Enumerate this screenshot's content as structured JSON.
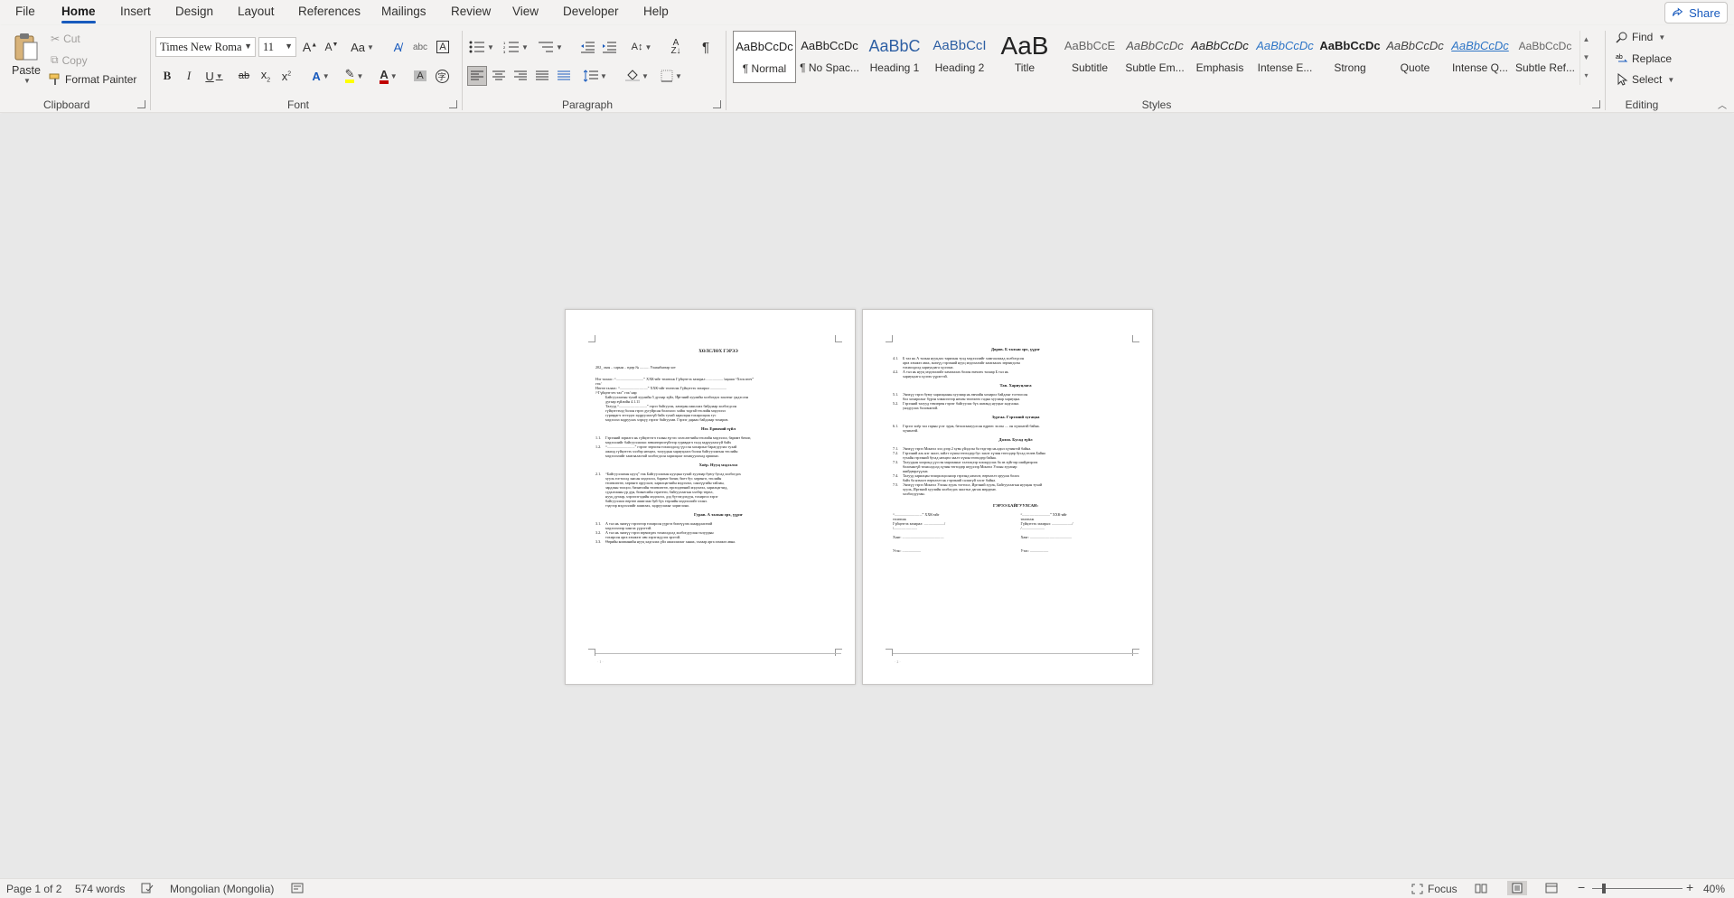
{
  "tabs": [
    "File",
    "Home",
    "Insert",
    "Design",
    "Layout",
    "References",
    "Mailings",
    "Review",
    "View",
    "Developer",
    "Help"
  ],
  "active_tab": "Home",
  "share_label": "Share",
  "clipboard": {
    "paste": "Paste",
    "cut": "Cut",
    "copy": "Copy",
    "format_painter": "Format Painter",
    "label": "Clipboard"
  },
  "font": {
    "name": "Times New Roma",
    "size": "11",
    "label": "Font"
  },
  "paragraph": {
    "label": "Paragraph"
  },
  "styles": {
    "label": "Styles",
    "items": [
      {
        "preview": "AaBbCcDc",
        "name": "¶ Normal"
      },
      {
        "preview": "AaBbCcDc",
        "name": "¶ No Spac..."
      },
      {
        "preview": "AaBbC",
        "name": "Heading 1"
      },
      {
        "preview": "AaBbCcI",
        "name": "Heading 2"
      },
      {
        "preview": "AaB",
        "name": "Title"
      },
      {
        "preview": "AaBbCcE",
        "name": "Subtitle"
      },
      {
        "preview": "AaBbCcDc",
        "name": "Subtle Em..."
      },
      {
        "preview": "AaBbCcDc",
        "name": "Emphasis"
      },
      {
        "preview": "AaBbCcDc",
        "name": "Intense E..."
      },
      {
        "preview": "AaBbCcDc",
        "name": "Strong"
      },
      {
        "preview": "AaBbCcDc",
        "name": "Quote"
      },
      {
        "preview": "AaBbCcDc",
        "name": "Intense Q..."
      },
      {
        "preview": "AaBbCcDc",
        "name": "Subtle Ref..."
      }
    ]
  },
  "editing": {
    "find": "Find",
    "replace": "Replace",
    "select": "Select",
    "label": "Editing"
  },
  "page1": {
    "title": "ХӨЛСЛӨХ ГЭРЭЭ",
    "meta": "202_ оны .. сарын .. өдөр                    № ..........                                          Улаанбаатар хот",
    "intro": [
      "Нэг талаас: “..............................” ХХК-ийг төлөөлж Гүйцэтгэх захирал .................. /ацааш “Хөлслөгч”",
      "гэх/",
      "Нөгөө талаас: “..............................” ХХК-ийг төлөөлж Гүйцэтгэх захирал ..................",
      "/“Гүйцэтгэгч тал” гэх/ нар",
      "Байгууллагын тухай хуулийн 5 дугаар зүйл, Иргэний хуулийн холбогдох заалтыг үндэслэн",
      "дугаар зүйлийн 4.1.11",
      "Талууд “..............................” гэрээ байгуулж, хамтран ажиллах байдлаар холбогдсон",
      "гүйцэтгэхэд болон гэрээ дугуйрсан болохоос хойш тадгай төслийн мэдээлэл",
      "гуравдагч этгээдээ задруулахгүй байх тухай харилцан тохиролцож тус",
      "мэдээлэл задруулах хэрхүү гэрээг байгуулав. Гэрээг дараах байдлаар тохиров."
    ],
    "sections": [
      {
        "head": "Нэг. Ерөнхий зүйл",
        "lines": [
          {
            "n": "1.1.",
            "t": "Гэрээний зорилго нь гүйцэтгэгч талын зүгээс хөлслөгчийн төслийн мэдээлэл, баримт бичиг,"
          },
          {
            "n": "",
            "t": "мэдээллийг байгууллагаас зөвшөөрөлгүйгээр гуравдагч талд задруулахгүй байх"
          },
          {
            "n": "1.2.",
            "t": "“..............................” гэрээг зөрчсөн тохиолдолд үүссэн хохирлыг барагдуулах тухай"
          },
          {
            "n": "",
            "t": "ажилд гүйцэтгэх хэлбэр нөхцөл, талуудын хариуцлага болон байгууллагын төслийн"
          },
          {
            "n": "",
            "t": "мэдээлэлийг хамгаалахтай холбогдсон харилцааг зохицуулахад оршино."
          }
        ]
      },
      {
        "head": "Хоёр. Нууц мэдээлэл",
        "lines": [
          {
            "n": "2.1.",
            "t": "“Байгууллагын нууц” гэж Байгууллагын нууцын тухай хуулиар буюу бусад холбогдох"
          },
          {
            "n": "",
            "t": "хууль тогтоолд заасан мэдээлэл, баримт бичиг, биет бус хөрөнгө, төслийн"
          },
          {
            "n": "",
            "t": "төлөвлөгөө, хөрөнгө оруулалт, харилцагчийн мэдээлэл, санхүүгийн тайлан,"
          },
          {
            "n": "",
            "t": "зардлын тооцоо, бизнесийн төлөвлөгөө, өрсөлдөөний мэдээлэл, харилцагчид,"
          },
          {
            "n": "",
            "t": "судалгааны үр дүн, бизнесийн стратеги, байгууллагын хэлбэр төрөл,"
          },
          {
            "n": "",
            "t": "нууц дугаар, хэрэглэгчдийн мэдээлэл, дэд бүтээгдэхүүн, тохиргоо зэрэг"
          },
          {
            "n": "",
            "t": "байгууллага өөртөө ашиглаж буй бүх төрлийн мэдээллийг хэлнэ."
          },
          {
            "n": "",
            "t": "тэдгээр мэдээллийг ашиглах, задруулахыг хориглоно."
          }
        ]
      },
      {
        "head": "Гурав. А талын эрх, үүрэг",
        "lines": [
          {
            "n": "3.1.",
            "t": "А тал нь энэхүү гэрээгээр тохирсон үүргээ биелүүлэх шаардлагатай"
          },
          {
            "n": "",
            "t": "мэдээлэлээр хангах үүрэгтэй."
          },
          {
            "n": "3.2.",
            "t": "А тал нь энэхүү гэрээ зөрчигдөх тохиолдолд холбогдуулан талуудын"
          },
          {
            "n": "",
            "t": "тохирсон арга хэмжээг авч хэрэгжүүлэх эрхтэй."
          },
          {
            "n": "3.3.",
            "t": "Өөрийн компанийн нууц хадгалах үйл ажиллагааг хянах, талаар арга хэмжээ авна."
          }
        ]
      }
    ],
    "footer": "· 1 ·"
  },
  "page2": {
    "sections": [
      {
        "head": "Дөрөв. Б талын эрх, үүрэг",
        "lines": [
          {
            "n": "4.1.",
            "t": "Б тал нь А талын нууцлах тарихын тулд мэдээллийг хамгаалахад холбогдсон"
          },
          {
            "n": "",
            "t": "арга хэмжээ авах, энэхүү гэрээний нууц мэдээллийг хамгаалах зөрчигдсөн"
          },
          {
            "n": "",
            "t": "тохиолдолд хариуцлага хүлээнэ."
          },
          {
            "n": "4.2.",
            "t": "А тал нь нууц мэдээллийг хамгаалах болон өмчлөх талаар Б тал нь"
          },
          {
            "n": "",
            "t": "хариуцлага хүлээх үүрэгтэй."
          }
        ]
      },
      {
        "head": "Тав. Хариуцлага",
        "lines": [
          {
            "n": "5.1.",
            "t": "Энэхүү гэрээ буюу харилцааны хуулиар нь өмчийн хохирол байдлыг тогтоосон"
          },
          {
            "n": "",
            "t": "бол хохиролыг бүрэн хэмжээгээр нөхөн төлөхөөс гадна хуулиар хариуцна."
          },
          {
            "n": "5.2.",
            "t": "Гэрээний талууд төвлөрөн гэрээг байгуулах бүх шатанд нууцыг хадгална."
          },
          {
            "n": "",
            "t": "уялдуулах боломжтой."
          }
        ]
      },
      {
        "head": "Зургаа. Гэрээний хугацаа",
        "lines": [
          {
            "n": "6.1.",
            "t": "Гэрээг хоёр тал гарын үсэг зурж, баталгаажуулсан өдрөөс эхлэн .... он хүчинтэй байна."
          },
          {
            "n": "",
            "t": "хүчинтэй."
          }
        ]
      },
      {
        "head": "Долоо. Бусад зүйл",
        "lines": [
          {
            "n": "7.1.",
            "t": "Энэхүү гэрээ Монгол хэл дээр 2 хувь үйлдсэн ба тэдгээр нь адил хүчинтэй байна."
          },
          {
            "n": "7.2.",
            "t": "Гэрээний аль нэг заалт, зайлт хүчин төгөлдөр бус заалт хүчин төгөлдөр бусад төлөв Байна"
          },
          {
            "n": "",
            "t": "тухайн гэрээний бусад нөхцөл заалт хүчин төгөлдөр байна."
          },
          {
            "n": "7.3.",
            "t": "Талуудын хооронд үүссэн маргааныг хэлэлцээр зохицуулах ба эв зүйгээр шийдвэрлэх"
          },
          {
            "n": "",
            "t": "боломжгүй тохиолдолд хүчин төгөлдөр шүүхээр Монгол Улсын хуулиар"
          },
          {
            "n": "",
            "t": "шийдвэрлүүлнэ."
          },
          {
            "n": "7.4.",
            "t": "Талууд харилцан тохиролцсоноор гэрээнд нэмэлт, өөрчлөлт оруулж болох"
          },
          {
            "n": "",
            "t": "байх ба нэмэлт өөрчлөлт нь гэрээний салшгүй хэсэг байна."
          },
          {
            "n": "7.5.",
            "t": "Энэхүү гэрээ Монгол Улсын хууль тогтоол, Иргэний хууль, Байгууллагын нууцын тухай"
          },
          {
            "n": "",
            "t": "хууль, Иргэний хуулийн холбогдох заалтыг дагаж мөрдөнө."
          },
          {
            "n": "",
            "t": "холбогдуулан."
          }
        ]
      }
    ],
    "sign_head": "ГЭРЭЭ БАЙГУУЛСАН:",
    "sign_left": [
      "“..............................” ХХК-ийг",
      "төлөөлж",
      "Гүйцэтгэх захирал: ....................../",
      "                          /.........................",
      "",
      "Хаяг: .............................................",
      "",
      "",
      "Утас: ...................."
    ],
    "sign_right": [
      "“..............................” ХХК-ийг",
      "төлөөлж",
      "Гүйцэтгэх захирал: ....................../",
      "                          /.........................",
      "",
      "Хаяг: .............................................",
      "",
      "",
      "Утас: ...................."
    ],
    "footer": "· 2 ·"
  },
  "status": {
    "page": "Page 1 of 2",
    "words": "574 words",
    "language": "Mongolian (Mongolia)",
    "focus": "Focus",
    "zoom": "40%",
    "zoom_fraction": 0.4
  },
  "colors": {
    "accent": "#185abd",
    "highlight": "#ffff00",
    "font_color": "#c00000"
  }
}
